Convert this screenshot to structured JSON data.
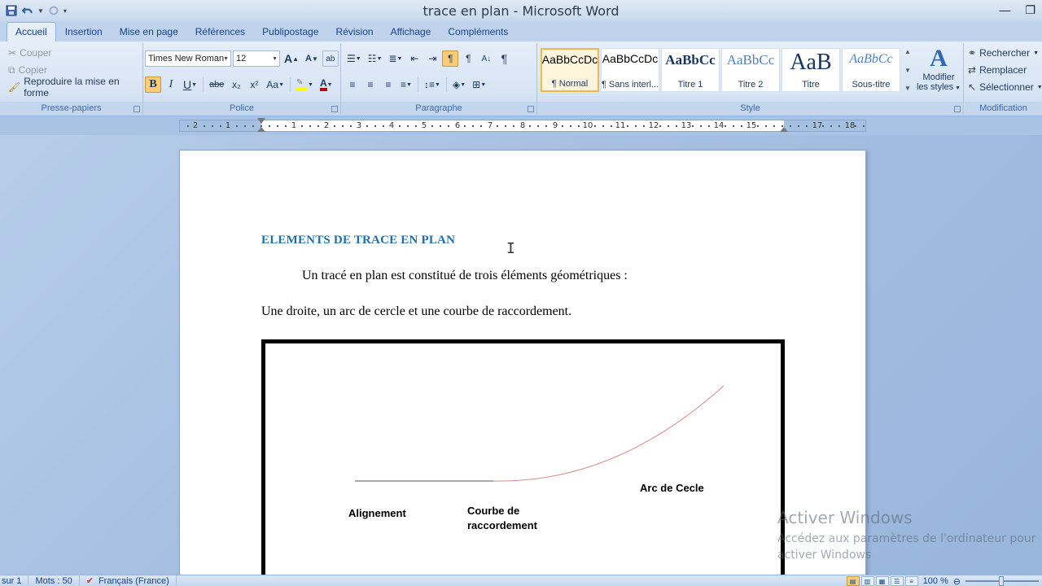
{
  "window": {
    "title": "trace en plan - Microsoft Word",
    "minimize_glyph": "—",
    "restore_glyph": "❐"
  },
  "quick_access": {
    "icons": [
      "save-icon",
      "undo-icon",
      "redo-icon",
      "customize-icon"
    ]
  },
  "tabs": [
    "Accueil",
    "Insertion",
    "Mise en page",
    "Références",
    "Publipostage",
    "Révision",
    "Affichage",
    "Compléments"
  ],
  "active_tab": "Accueil",
  "clipboard": {
    "label": "Presse-papiers",
    "cut": "Couper",
    "copy": "Copier",
    "format_painter": "Reproduire la mise en forme"
  },
  "font": {
    "label": "Police",
    "family": "Times New Roman",
    "size": "12",
    "bold": "B",
    "italic": "I",
    "underline": "U",
    "strike": "abe",
    "subscript": "x₂",
    "superscript": "x²",
    "change_case": "Aa",
    "grow": "A",
    "shrink": "A",
    "highlight_color": "#ffff00",
    "font_color": "#c00000"
  },
  "paragraph": {
    "label": "Paragraphe"
  },
  "styles": {
    "label": "Style",
    "items": [
      {
        "sample": "AaBbCcDc",
        "name": "¶ Normal"
      },
      {
        "sample": "AaBbCcDc",
        "name": "¶ Sans interl..."
      },
      {
        "sample": "AaBbCc",
        "name": "Titre 1"
      },
      {
        "sample": "AaBbCc",
        "name": "Titre 2"
      },
      {
        "sample": "AaB",
        "name": "Titre"
      },
      {
        "sample": "AaBbCc",
        "name": "Sous-titre"
      }
    ],
    "change_styles_line1": "Modifier",
    "change_styles_line2": "les styles"
  },
  "editing": {
    "label": "Modification",
    "find": "Rechercher",
    "replace": "Remplacer",
    "select": "Sélectionner"
  },
  "ruler": {
    "labels": [
      "2",
      "1",
      "1",
      "2",
      "3",
      "4",
      "5",
      "6",
      "7",
      "8",
      "9",
      "10",
      "11",
      "12",
      "13",
      "14",
      "15",
      "17",
      "18"
    ]
  },
  "document": {
    "heading": "ELEMENTS DE TRACE EN PLAN",
    "para1": "Un tracé en plan est constitué de trois éléments géométriques :",
    "para2": "Une droite, un arc de cercle et une courbe de raccordement.",
    "figure": {
      "label_alignment": "Alignement",
      "label_transition_1": "Courbe de",
      "label_transition_2": "raccordement",
      "label_arc": "Arc de Cecle"
    }
  },
  "watermark": {
    "line1": "Activer Windows",
    "line2": "Accédez aux paramètres de l'ordinateur pour",
    "line3": "activer Windows"
  },
  "status": {
    "page": "sur 1",
    "words": "Mots : 50",
    "language": "Français (France)",
    "zoom": "100 %"
  }
}
